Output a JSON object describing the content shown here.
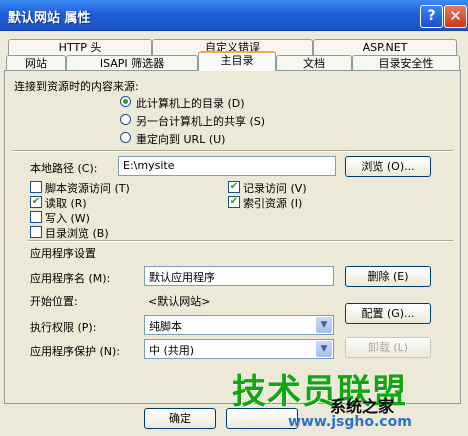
{
  "window": {
    "title": "默认网站 属性",
    "help_glyph": "?",
    "close_glyph": "✕"
  },
  "tabs_row1": [
    "HTTP 头",
    "自定义错误",
    "ASP.NET"
  ],
  "tabs_row2": [
    "网站",
    "ISAPI 筛选器",
    "主目录",
    "文档",
    "目录安全性"
  ],
  "content_source": {
    "label": "连接到资源时的内容来源:",
    "options": [
      "此计算机上的目录 (D)",
      "另一台计算机上的共享 (S)",
      "重定向到 URL (U)"
    ],
    "selected_index": 0
  },
  "local_path": {
    "label": "本地路径 (C):",
    "value": "E:\\mysite",
    "browse_label": "浏览 (O)..."
  },
  "permissions": {
    "script_source": {
      "label": "脚本资源访问 (T)",
      "checked": false
    },
    "log_visits": {
      "label": "记录访问 (V)",
      "checked": true
    },
    "read": {
      "label": "读取 (R)",
      "checked": true
    },
    "index_resource": {
      "label": "索引资源 (I)",
      "checked": true
    },
    "write": {
      "label": "写入 (W)",
      "checked": false
    },
    "dir_browse": {
      "label": "目录浏览 (B)",
      "checked": false
    }
  },
  "app_settings": {
    "heading": "应用程序设置",
    "app_name_label": "应用程序名 (M):",
    "app_name_value": "默认应用程序",
    "remove_label": "删除 (E)",
    "start_label": "开始位置:",
    "start_value": "<默认网站>",
    "config_label": "配置 (G)...",
    "exec_label": "执行权限 (P):",
    "exec_value": "纯脚本",
    "protect_label": "应用程序保护 (N):",
    "protect_value": "中 (共用)",
    "unload_label": "卸载 (L)"
  },
  "footer": {
    "ok_label": "确定"
  },
  "watermark": {
    "brand": "技术员联盟",
    "brand2": "系统之家",
    "url": "www.jsgho.com"
  },
  "colors": {
    "title_bar": "#1f5fd9",
    "check_mark": "#21a121",
    "watermark": "#11a711"
  }
}
